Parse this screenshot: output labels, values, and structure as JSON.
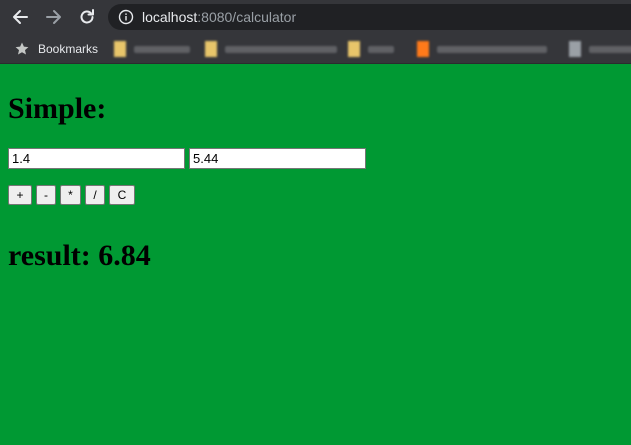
{
  "browser": {
    "url_host": "localhost",
    "url_path": ":8080/calculator",
    "bookmarks_label": "Bookmarks",
    "bookmark_items": [
      {
        "favicon_color": "#e8c56a",
        "blur_width": 56
      },
      {
        "favicon_color": "#e8c56a",
        "blur_width": 112
      },
      {
        "favicon_color": "#e8c56a",
        "blur_width": 26
      },
      {
        "favicon_color": "#ff7a1a",
        "blur_width": 110
      },
      {
        "favicon_color": "#9aa0a6",
        "blur_width": 46
      }
    ]
  },
  "page": {
    "title": "Simple:",
    "input_a": "1.4",
    "input_b": "5.44",
    "buttons": {
      "add": "+",
      "subtract": "-",
      "multiply": "*",
      "divide": "/",
      "clear": "C"
    },
    "result_text": "result: 6.84"
  },
  "colors": {
    "page_background": "#009933",
    "chrome_background": "#35363a",
    "omnibox_background": "#202124"
  }
}
